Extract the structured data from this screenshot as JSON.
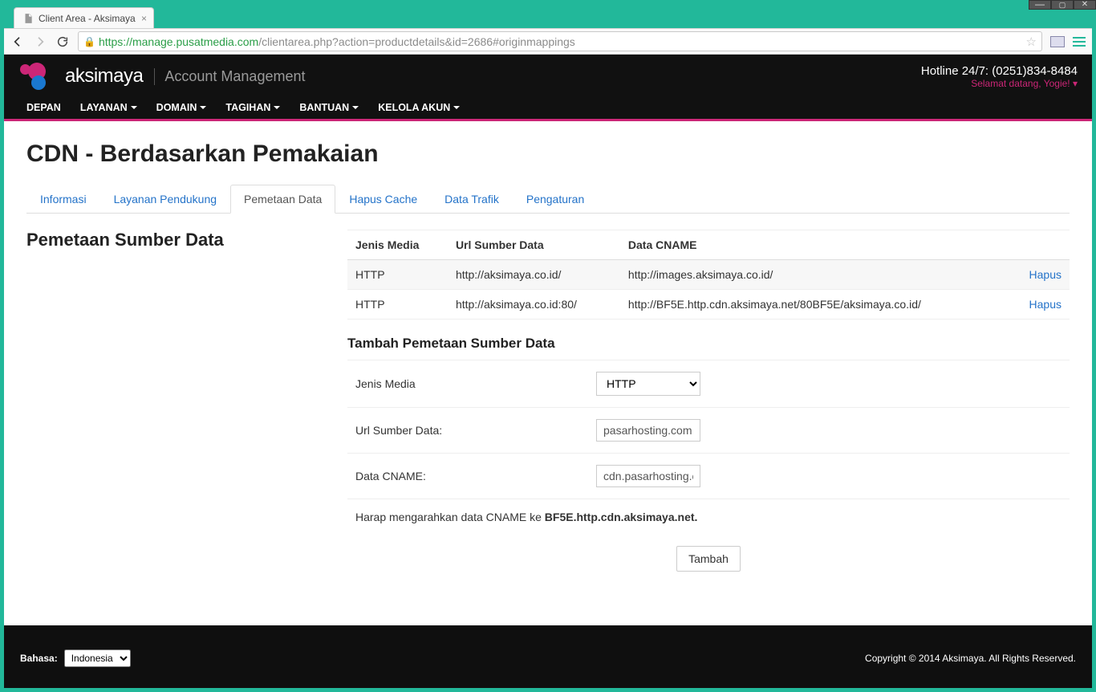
{
  "os_window": {
    "controls": [
      "minimize",
      "maximize",
      "close"
    ]
  },
  "browser": {
    "tab_title": "Client Area - Aksimaya",
    "url_secure_host": "https://manage.pusatmedia.com",
    "url_path": "/clientarea.php?action=productdetails&id=2686#originmappings"
  },
  "header": {
    "brand": "aksimaya",
    "subtitle": "Account Management",
    "hotline_label": "Hotline 24/7: (0251)834-8484",
    "welcome": "Selamat datang, Yogie! ▾"
  },
  "nav": [
    {
      "label": "DEPAN",
      "caret": false
    },
    {
      "label": "LAYANAN",
      "caret": true
    },
    {
      "label": "DOMAIN",
      "caret": true
    },
    {
      "label": "TAGIHAN",
      "caret": true
    },
    {
      "label": "BANTUAN",
      "caret": true
    },
    {
      "label": "KELOLA AKUN",
      "caret": true
    }
  ],
  "page": {
    "title": "CDN - Berdasarkan Pemakaian",
    "tabs": [
      {
        "label": "Informasi",
        "active": false
      },
      {
        "label": "Layanan Pendukung",
        "active": false
      },
      {
        "label": "Pemetaan Data",
        "active": true
      },
      {
        "label": "Hapus Cache",
        "active": false
      },
      {
        "label": "Data Trafik",
        "active": false
      },
      {
        "label": "Pengaturan",
        "active": false
      }
    ],
    "section_heading": "Pemetaan Sumber Data",
    "table": {
      "headers": [
        "Jenis Media",
        "Url Sumber Data",
        "Data CNAME",
        ""
      ],
      "rows": [
        {
          "media": "HTTP",
          "url": "http://aksimaya.co.id/",
          "cname": "http://images.aksimaya.co.id/",
          "action": "Hapus"
        },
        {
          "media": "HTTP",
          "url": "http://aksimaya.co.id:80/",
          "cname": "http://BF5E.http.cdn.aksimaya.net/80BF5E/aksimaya.co.id/",
          "action": "Hapus"
        }
      ]
    },
    "form": {
      "title": "Tambah Pemetaan Sumber Data",
      "field_media_label": "Jenis Media",
      "field_media_value": "HTTP",
      "field_url_label": "Url Sumber Data:",
      "field_url_value": "pasarhosting.com",
      "field_cname_label": "Data CNAME:",
      "field_cname_value": "cdn.pasarhosting.com",
      "instruction_prefix": "Harap mengarahkan data CNAME ke ",
      "instruction_bold": "BF5E.http.cdn.aksimaya.net.",
      "submit_label": "Tambah"
    }
  },
  "footer": {
    "lang_label": "Bahasa:",
    "lang_value": "Indonesia",
    "copyright": "Copyright © 2014 Aksimaya. All Rights Reserved."
  }
}
